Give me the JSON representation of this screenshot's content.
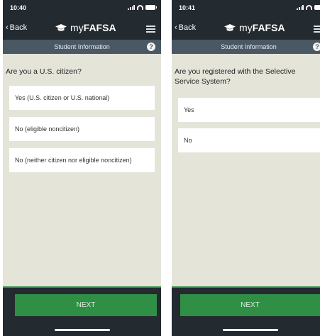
{
  "screens": [
    {
      "status": {
        "time": "10:40"
      },
      "nav": {
        "back_label": "Back",
        "brand_prefix": "my",
        "brand_bold": "FAFSA"
      },
      "section_title": "Student Information",
      "help_label": "?",
      "question": "Are you a U.S. citizen?",
      "options": [
        "Yes (U.S. citizen or U.S. national)",
        "No (eligible noncitizen)",
        "No (neither citizen nor eligible noncitizen)"
      ],
      "next_label": "NEXT"
    },
    {
      "status": {
        "time": "10:41"
      },
      "nav": {
        "back_label": "Back",
        "brand_prefix": "my",
        "brand_bold": "FAFSA"
      },
      "section_title": "Student Information",
      "help_label": "?",
      "question": "Are you registered with the Selective Service System?",
      "options": [
        "Yes",
        "No"
      ],
      "next_label": "NEXT"
    }
  ],
  "colors": {
    "nav_bg": "#232a30",
    "subheader_bg": "#4a5864",
    "content_bg": "#e5e4d9",
    "accent_green": "#2f8f45"
  },
  "icons": {
    "back": "chevron-left-icon",
    "brand": "graduation-cap-icon",
    "menu": "hamburger-menu-icon",
    "help": "question-circle-icon"
  }
}
